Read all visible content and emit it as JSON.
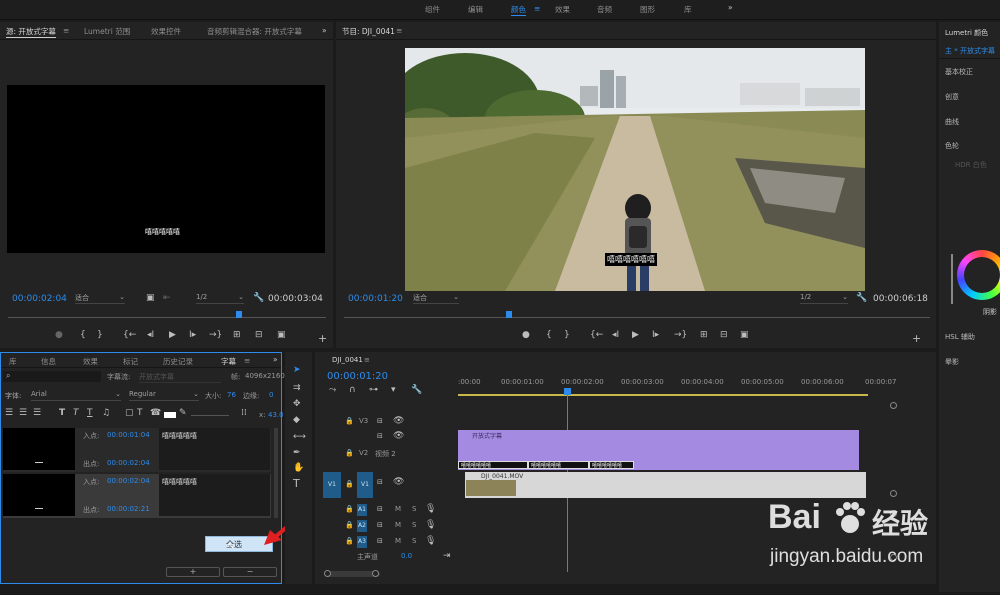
{
  "workspaces": {
    "items": [
      "组件",
      "编辑",
      "颜色",
      "效果",
      "音频",
      "图形",
      "库"
    ],
    "active_index": 2,
    "more": "»"
  },
  "source_panel": {
    "tabs": [
      "源: 开放式字幕",
      "Lumetri 范围",
      "效果控件",
      "音频剪辑混合器: 开放式字幕"
    ],
    "caption": "嘻嘻嘻嘻嘻",
    "timecode_in": "00:00:02:04",
    "fit": "适合",
    "ratio": "1/2",
    "timecode_out": "00:00:03:04"
  },
  "program_panel": {
    "title": "节目: DJI_0041",
    "caption": "嘻嘻嘻嘻嘻嘻",
    "timecode_in": "00:00:01:20",
    "fit": "适合",
    "ratio": "1/2",
    "timecode_out": "00:00:06:18"
  },
  "lumetri": {
    "title": "Lumetri 颜色",
    "source": "主 * 开放式字幕",
    "sections": [
      "基本校正",
      "创意",
      "曲线",
      "色轮",
      "HSL 辅助",
      "晕影"
    ],
    "hdr": "HDR 白色",
    "shadow": "阴影"
  },
  "captions_panel": {
    "tabs": [
      "库",
      "信息",
      "效果",
      "标记",
      "历史记录",
      "字幕"
    ],
    "stream_label": "字幕流:",
    "stream_value": "开放式字幕",
    "frame_label": "帧:",
    "frame_value": "4096x2160",
    "font_label": "字体:",
    "font_value": "Arial",
    "style_value": "Regular",
    "size_label": "大小:",
    "size_value": "76",
    "edge_label": "边缘:",
    "edge_value": "0",
    "x_label": "x:",
    "x_value": "43.0",
    "entries": [
      {
        "in_label": "入点:",
        "in_time": "00:00:01:04",
        "out_label": "出点:",
        "out_time": "00:00:02:04",
        "text": "嘻嘻嘻嘻嘻"
      },
      {
        "in_label": "入点:",
        "in_time": "00:00:02:04",
        "out_label": "出点:",
        "out_time": "00:00:02:21",
        "text": "嘻嘻嘻嘻嘻"
      }
    ],
    "select_all": "全选",
    "add": "+",
    "remove": "−"
  },
  "timeline": {
    "sequence": "DJI_0041",
    "timecode": "00:00:01:20",
    "ruler": [
      ":00:00",
      "00:00:01:00",
      "00:00:02:00",
      "00:00:03:00",
      "00:00:04:00",
      "00:00:05:00",
      "00:00:06:00",
      "00:00:07"
    ],
    "tracks": {
      "v3": "V3",
      "v2": "V2",
      "v2_name": "视频 2",
      "v1": "V1",
      "a1": "A1",
      "a2": "A2",
      "a3": "A3",
      "master": "主声道",
      "master_value": "0.0",
      "m": "M",
      "s": "S"
    },
    "caption_clip": "开放式字幕",
    "caption_segments": [
      "嘻嘻嘻嘻嘻嘻",
      "嘻嘻嘻嘻嘻嘻",
      "嘻嘻嘻嘻嘻嘻"
    ],
    "video_clip": "DJI_0041.MOV"
  },
  "watermark": {
    "brand": "Bai",
    "brand2": "经验",
    "url": "jingyan.baidu.com"
  }
}
